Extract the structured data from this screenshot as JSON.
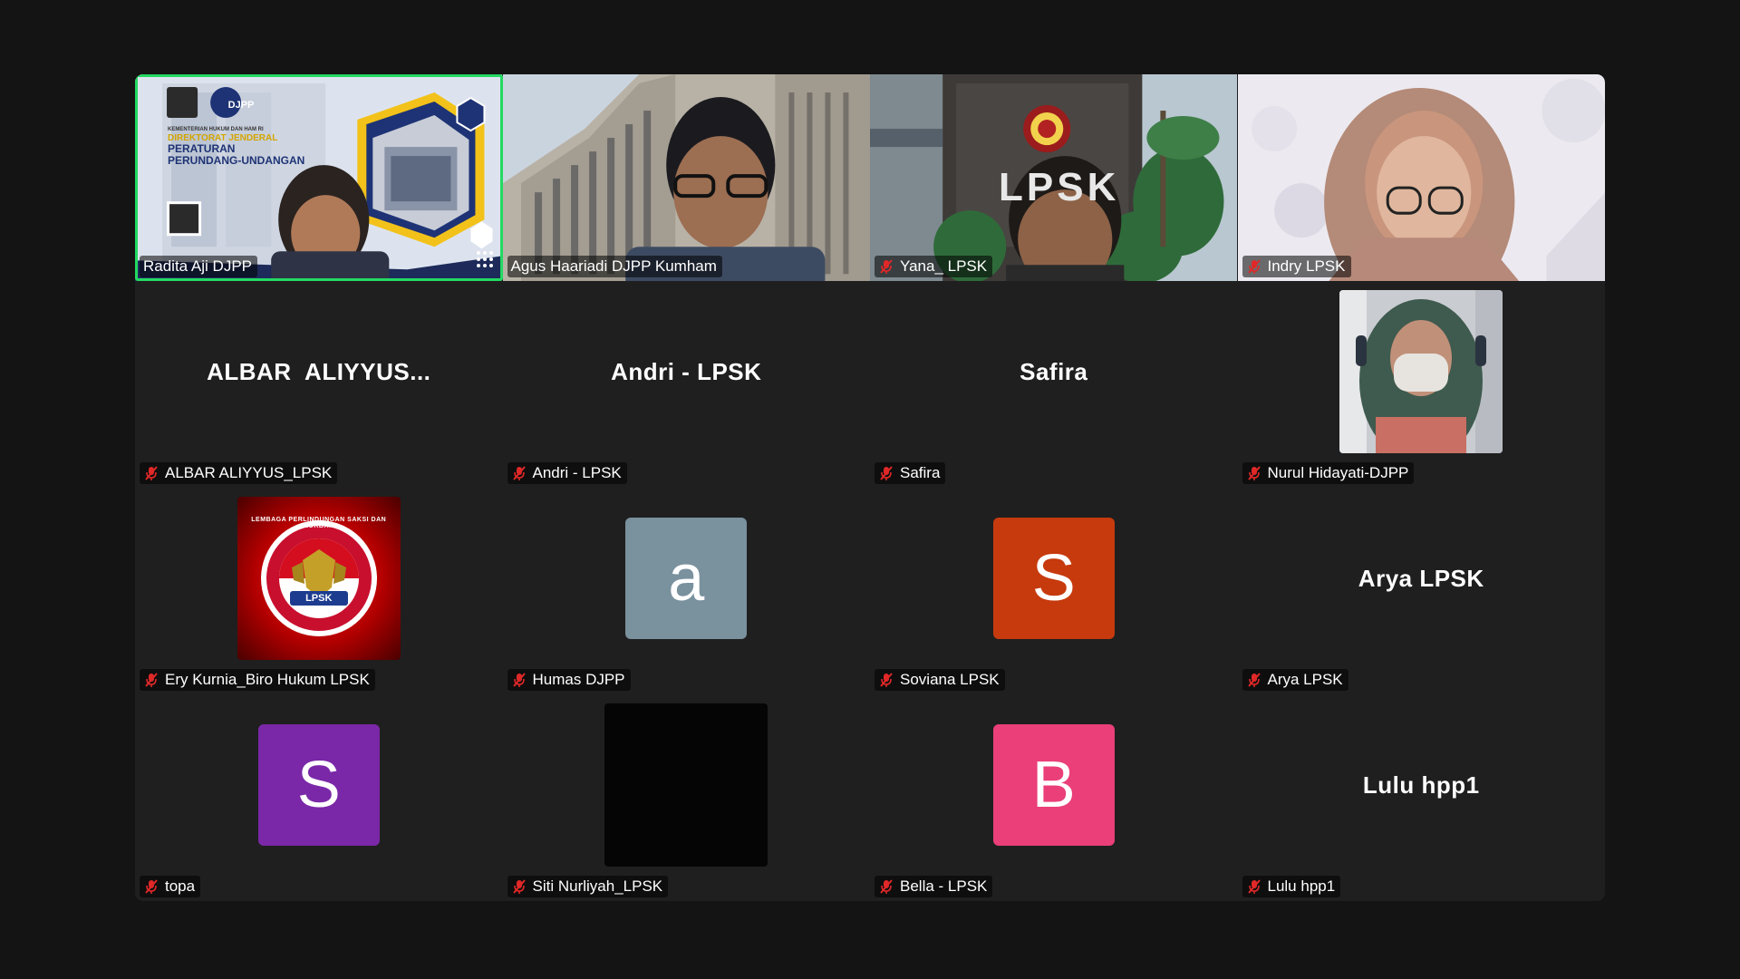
{
  "participants": [
    {
      "name": "Radita Aji DJPP",
      "muted": false,
      "kind": "video",
      "active": true,
      "slide": {
        "brand": "DJPP",
        "line1": "KEMENTERIAN HUKUM DAN HAM RI",
        "line2": "DIREKTORAT JENDERAL",
        "line3": "PERATURAN",
        "line4": "PERUNDANG-UNDANGAN"
      }
    },
    {
      "name": "Agus Haariadi DJPP Kumham",
      "muted": false,
      "kind": "video"
    },
    {
      "name": "Yana_ LPSK",
      "muted": true,
      "kind": "video",
      "sign": "LPSK"
    },
    {
      "name": "Indry LPSK",
      "muted": true,
      "kind": "video"
    },
    {
      "name": "ALBAR ALIYYUS_LPSK",
      "muted": true,
      "kind": "text",
      "display": "ALBAR  ALIYYUS..."
    },
    {
      "name": "Andri - LPSK",
      "muted": true,
      "kind": "text",
      "display": "Andri - LPSK"
    },
    {
      "name": "Safira",
      "muted": true,
      "kind": "text",
      "display": "Safira"
    },
    {
      "name": "Nurul Hidayati-DJPP",
      "muted": true,
      "kind": "photo",
      "photo": "hijab-mask-portrait"
    },
    {
      "name": "Ery Kurnia_Biro Hukum LPSK",
      "muted": true,
      "kind": "photo",
      "photo": "lpsk-emblem",
      "emblem": {
        "ring_text": "LEMBAGA PERLINDUNGAN SAKSI DAN KORBAN",
        "banner": "LPSK"
      }
    },
    {
      "name": "Humas DJPP",
      "muted": true,
      "kind": "letter",
      "letter": "a",
      "color": "#7a919e"
    },
    {
      "name": "Soviana LPSK",
      "muted": true,
      "kind": "letter",
      "letter": "S",
      "color": "#c63a0d"
    },
    {
      "name": "Arya LPSK",
      "muted": true,
      "kind": "text",
      "display": "Arya LPSK"
    },
    {
      "name": "topa",
      "muted": true,
      "kind": "letter",
      "letter": "S",
      "color": "#7a28a8"
    },
    {
      "name": "Siti Nurliyah_LPSK",
      "muted": true,
      "kind": "photo",
      "photo": "black-image"
    },
    {
      "name": "Bella - LPSK",
      "muted": true,
      "kind": "letter",
      "letter": "B",
      "color": "#ea3f78"
    },
    {
      "name": "Lulu hpp1",
      "muted": true,
      "kind": "text",
      "display": "Lulu hpp1"
    }
  ],
  "colors": {
    "background": "#141414",
    "tile": "#1f1f1f",
    "active_border": "#23d962",
    "mute_icon": "#e02828"
  }
}
